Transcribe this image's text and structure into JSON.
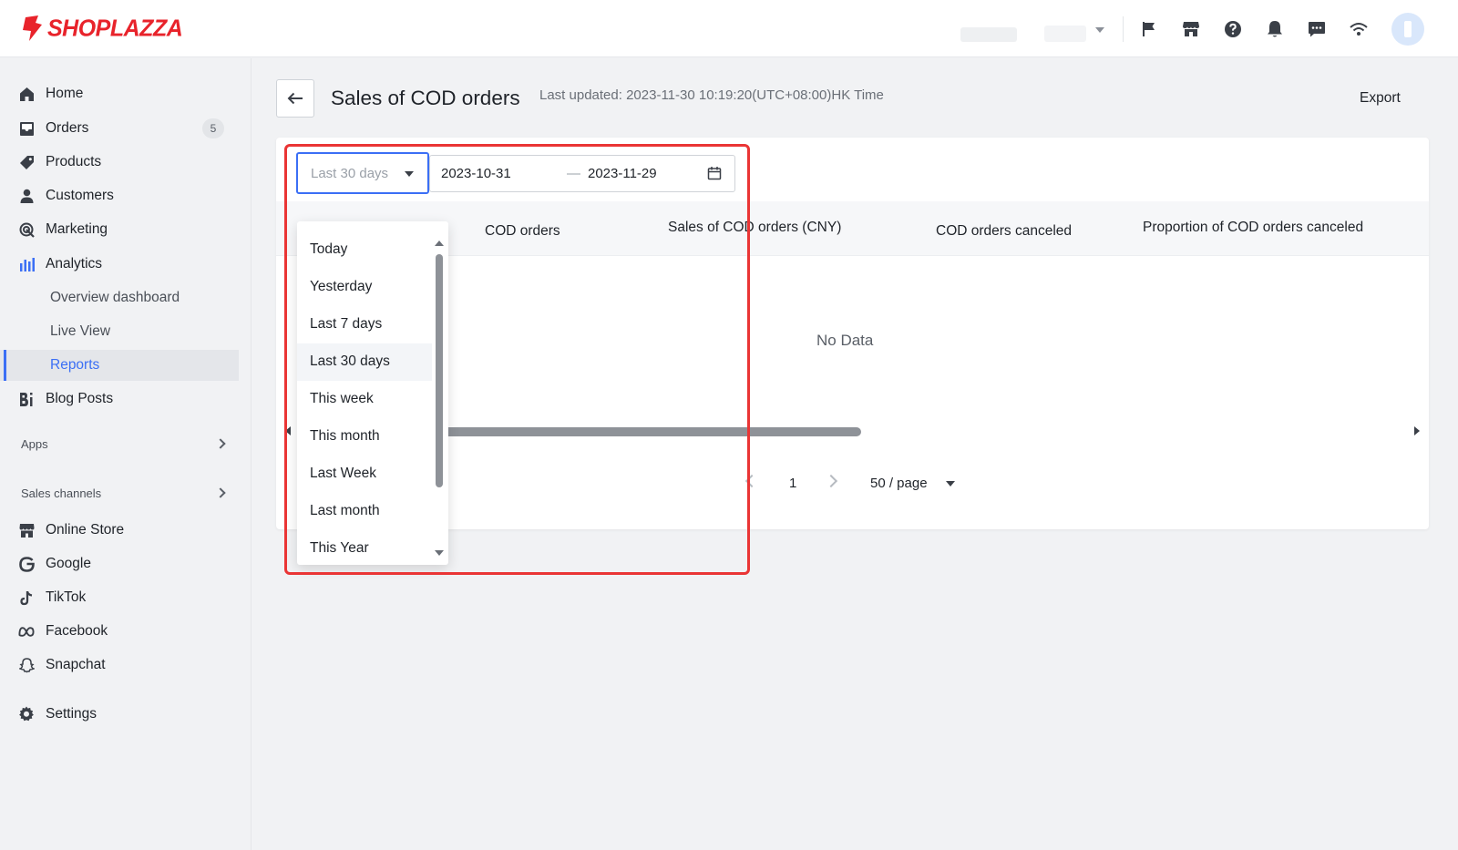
{
  "brand": {
    "name": "SHOPLAZZA",
    "color": "#e8232b"
  },
  "colors": {
    "accent": "#3b6ff5",
    "highlight": "#ea3535"
  },
  "topbar": {
    "icons": [
      "flag-icon",
      "store-icon",
      "help-icon",
      "bell-icon",
      "chat-icon",
      "wifi-icon"
    ]
  },
  "sidebar": {
    "items": [
      {
        "label": "Home",
        "icon": "home-icon"
      },
      {
        "label": "Orders",
        "icon": "inbox-icon",
        "badge": "5"
      },
      {
        "label": "Products",
        "icon": "tag-icon"
      },
      {
        "label": "Customers",
        "icon": "person-icon"
      },
      {
        "label": "Marketing",
        "icon": "target-icon"
      },
      {
        "label": "Analytics",
        "icon": "bar-chart-icon"
      }
    ],
    "analytics_sub": [
      {
        "label": "Overview dashboard"
      },
      {
        "label": "Live View"
      },
      {
        "label": "Reports",
        "active": true
      }
    ],
    "blog": {
      "label": "Blog Posts",
      "icon": "blog-icon"
    },
    "apps_label": "Apps",
    "sales_channels_label": "Sales channels",
    "channels": [
      {
        "label": "Online Store",
        "icon": "storefront-icon"
      },
      {
        "label": "Google",
        "icon": "google-icon"
      },
      {
        "label": "TikTok",
        "icon": "tiktok-icon"
      },
      {
        "label": "Facebook",
        "icon": "meta-icon"
      },
      {
        "label": "Snapchat",
        "icon": "snapchat-icon"
      }
    ],
    "settings": {
      "label": "Settings",
      "icon": "gear-icon"
    }
  },
  "header": {
    "title": "Sales of COD orders",
    "last_updated": "Last updated: 2023-11-30 10:19:20(UTC+08:00)HK Time",
    "export_label": "Export"
  },
  "filters": {
    "range_value": "Last 30 days",
    "start_date": "2023-10-31",
    "separator": "—",
    "end_date": "2023-11-29"
  },
  "table": {
    "columns": [
      "COD orders",
      "Sales of COD orders (CNY)",
      "COD orders canceled",
      "Proportion of COD orders canceled"
    ],
    "empty_text": "No Data"
  },
  "pagination": {
    "current_page": "1",
    "page_size": "50 / page"
  },
  "range_options": [
    {
      "label": "Today"
    },
    {
      "label": "Yesterday"
    },
    {
      "label": "Last 7 days"
    },
    {
      "label": "Last 30 days",
      "selected": true
    },
    {
      "label": "This week"
    },
    {
      "label": "This month"
    },
    {
      "label": "Last Week"
    },
    {
      "label": "Last month"
    },
    {
      "label": "This Year"
    }
  ]
}
